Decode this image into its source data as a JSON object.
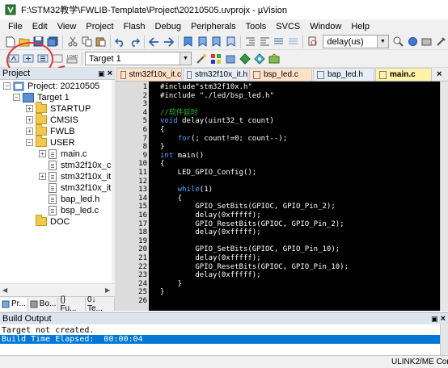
{
  "window": {
    "title": "F:\\STM32教学\\FWLIB-Template\\Project\\20210505.uvprojx - µVision"
  },
  "menu": [
    "File",
    "Edit",
    "View",
    "Project",
    "Flash",
    "Debug",
    "Peripherals",
    "Tools",
    "SVCS",
    "Window",
    "Help"
  ],
  "toolbar": {
    "function_combo": "delay(us)",
    "target_combo": "Target 1"
  },
  "project_panel": {
    "title": "Project",
    "tree": [
      {
        "label": "Project: 20210505",
        "kind": "root"
      },
      {
        "label": "Target 1",
        "kind": "target"
      },
      {
        "label": "STARTUP",
        "kind": "folder"
      },
      {
        "label": "CMSIS",
        "kind": "folder"
      },
      {
        "label": "FWLB",
        "kind": "folder"
      },
      {
        "label": "USER",
        "kind": "folder"
      },
      {
        "label": "main.c",
        "kind": "file"
      },
      {
        "label": "stm32f10x_conf.",
        "kind": "file"
      },
      {
        "label": "stm32f10x_it.c",
        "kind": "file"
      },
      {
        "label": "stm32f10x_it.h",
        "kind": "file"
      },
      {
        "label": "bap_led.h",
        "kind": "file"
      },
      {
        "label": "bsp_led.c",
        "kind": "file"
      },
      {
        "label": "DOC",
        "kind": "folder"
      }
    ],
    "tabs": [
      "Pr...",
      "Bo...",
      "{} Fu...",
      "0↓ Te..."
    ]
  },
  "editor": {
    "tabs": [
      {
        "label": "stm32f10x_it.c",
        "kind": "c"
      },
      {
        "label": "stm32f10x_it.h",
        "kind": "h"
      },
      {
        "label": "bsp_led.c",
        "kind": "c"
      },
      {
        "label": "bap_led.h",
        "kind": "h"
      },
      {
        "label": "main.c",
        "kind": "active"
      }
    ],
    "lines": [
      {
        "n": "1",
        "text": "#include\"stm32f10x.h\"",
        "color": "#ffffff"
      },
      {
        "n": "2",
        "text": "#include \"./led/bsp_led.h\"",
        "color": "#ffffff"
      },
      {
        "n": "3",
        "text": "",
        "color": "#ffffff"
      },
      {
        "n": "4",
        "text": "//软件延时",
        "color": "#2eb82e"
      },
      {
        "n": "5",
        "text": "void delay(uint32_t count)",
        "color": "#ffffff"
      },
      {
        "n": "6",
        "text": "{",
        "color": "#ffffff"
      },
      {
        "n": "7",
        "text": "    for(; count!=0; count--);",
        "color": "#ffffff"
      },
      {
        "n": "8",
        "text": "}",
        "color": "#ffffff"
      },
      {
        "n": "9",
        "text": "int main()",
        "color": "#ffffff"
      },
      {
        "n": "10",
        "text": "{",
        "color": "#ffffff"
      },
      {
        "n": "11",
        "text": "    LED_GPIO_Config();",
        "color": "#ffffff"
      },
      {
        "n": "12",
        "text": "",
        "color": "#ffffff"
      },
      {
        "n": "13",
        "text": "    while(1)",
        "color": "#ffffff"
      },
      {
        "n": "14",
        "text": "    {",
        "color": "#ffffff"
      },
      {
        "n": "15",
        "text": "        GPIO_SetBits(GPIOC, GPIO_Pin_2);",
        "color": "#ffffff"
      },
      {
        "n": "16",
        "text": "        delay(0xfffff);",
        "color": "#ffffff"
      },
      {
        "n": "17",
        "text": "        GPIO_ResetBits(GPIOC, GPIO_Pin_2);",
        "color": "#ffffff"
      },
      {
        "n": "18",
        "text": "        delay(0xfffff);",
        "color": "#ffffff"
      },
      {
        "n": "19",
        "text": "",
        "color": "#ffffff"
      },
      {
        "n": "20",
        "text": "        GPIO_SetBits(GPIOC, GPIO_Pin_10);",
        "color": "#ffffff"
      },
      {
        "n": "21",
        "text": "        delay(0xfffff);",
        "color": "#ffffff"
      },
      {
        "n": "22",
        "text": "        GPIO_ResetBits(GPIOC, GPIO_Pin_10);",
        "color": "#ffffff"
      },
      {
        "n": "23",
        "text": "        delay(0xfffff);",
        "color": "#ffffff"
      },
      {
        "n": "24",
        "text": "    }",
        "color": "#ffffff"
      },
      {
        "n": "25",
        "text": "}",
        "color": "#ffffff"
      },
      {
        "n": "26",
        "text": "",
        "color": "#ffffff"
      }
    ]
  },
  "build_output": {
    "title": "Build Output",
    "lines": [
      "Target not created.",
      "Build Time Elapsed:  00:00:04"
    ]
  },
  "status": {
    "debugger": "ULINK2/ME Cortex"
  },
  "colors": {
    "annotation": "#e53935",
    "keyword": "#4fa3ff",
    "selection": "#0078d7"
  }
}
